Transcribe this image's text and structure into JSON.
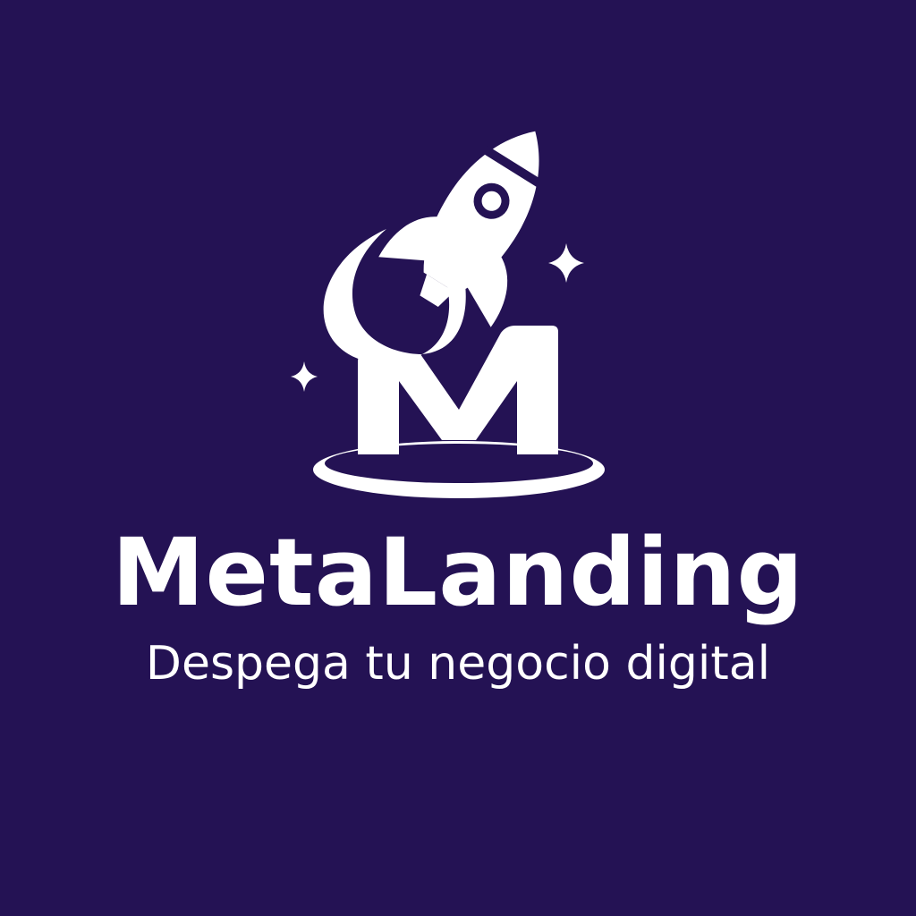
{
  "brand": {
    "name": "MetaLanding",
    "tagline": "Despega tu negocio digital",
    "monogram": "M"
  },
  "colors": {
    "background": "#241254",
    "foreground": "#ffffff"
  },
  "icons": [
    "rocket-icon",
    "sparkle-icon",
    "landing-pad-icon",
    "m-monogram-icon"
  ]
}
